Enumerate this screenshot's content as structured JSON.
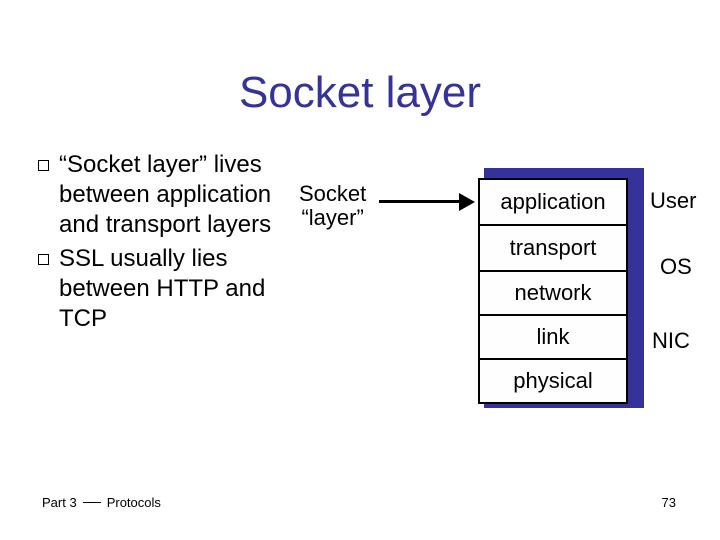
{
  "title": "Socket layer",
  "bullets": [
    "“Socket layer” lives between application and transport layers",
    "SSL usually lies between HTTP and TCP"
  ],
  "socket_label": {
    "line1": "Socket",
    "line2": "“layer”"
  },
  "stack": {
    "layers": [
      "application",
      "transport",
      "network",
      "link",
      "physical"
    ]
  },
  "side_labels": {
    "user": "User",
    "os": "OS",
    "nic": "NIC"
  },
  "footer": {
    "left_a": "Part 3",
    "left_b": "Protocols",
    "page": "73"
  },
  "colors": {
    "accent": "#353399"
  }
}
